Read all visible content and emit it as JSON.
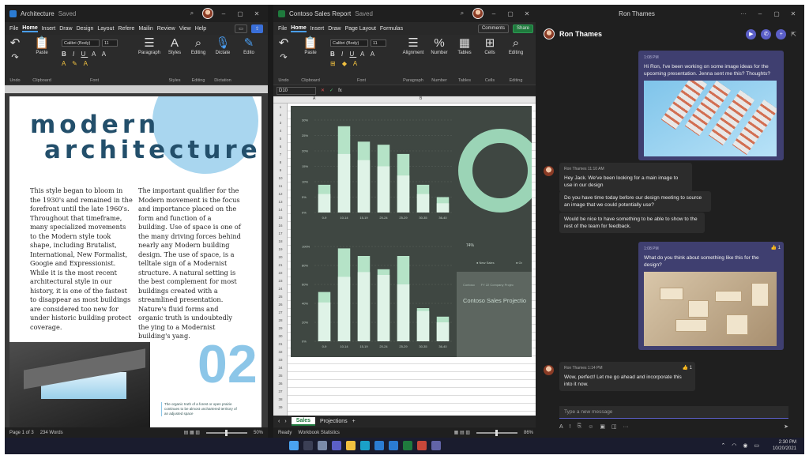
{
  "word": {
    "title": "Architecture",
    "saved": "Saved",
    "menu": [
      "File",
      "Home",
      "Insert",
      "Draw",
      "Design",
      "Layout",
      "Refere",
      "Mailin",
      "Review",
      "View",
      "Help"
    ],
    "ribbon": {
      "undo": "Undo",
      "paste": "Paste",
      "clipboard": "Clipboard",
      "font_name": "Calibri (Body)",
      "font_size": "11",
      "font": "Font",
      "paragraph": "Paragraph",
      "styles": "Styles",
      "editing": "Editing",
      "dictate": "Dictate",
      "dictation": "Dictation",
      "edito": "Edito"
    },
    "heading1": "modern",
    "heading2": "architecture",
    "col1": "This style began to bloom in the 1930's and remained in the forefront until the late 1960's. Throughout that timeframe, many specialized movements to the Modern style took shape, including Brutalist, International, New Formalist, Googie and Expressionist. While it is the most recent architectural style in our history, it is one of the fastest to disappear as most buildings are considered too new for under historic building protect coverage.",
    "col2": "The important qualifier for the Modern movement is the focus and importance placed on the form and function of a building. Use of space is one of the many driving forces behind nearly any Modern building design. The use of space, is a telltale sign of a Modernist structure. A natural setting is the best complement for most buildings created with a streamlined presentation. Nature's fluid forms and organic truth is undoubtedly the ying to a Modernist building's yang.",
    "big_number": "02",
    "caption": "The organic truth of a forest or open prairie continues to be almost unchartered territory of an adjusted space",
    "status": {
      "page": "Page 1 of 3",
      "words": "234 Words",
      "zoom": "50%"
    }
  },
  "excel": {
    "title": "Contoso Sales Report",
    "saved": "Saved",
    "menu": [
      "File",
      "Home",
      "Insert",
      "Draw",
      "Page Layout",
      "Formulas"
    ],
    "comments": "Comments",
    "share": "Share",
    "ribbon": {
      "undo": "Undo",
      "paste": "Paste",
      "clipboard": "Clipboard",
      "font_name": "Calibri (Body)",
      "font_size": "11",
      "font": "Font",
      "alignment": "Alignment",
      "number": "Number",
      "tables": "Tables",
      "cells": "Cells",
      "editing": "Editing",
      "paragraph": "Paragraph"
    },
    "namebox": "D10",
    "fx": "fx",
    "col_headers": [
      "A",
      "B"
    ],
    "project_title": "Contoso Sales Projectio",
    "donut_label": "74%",
    "legend": [
      "New Sales",
      "Gr"
    ],
    "sheet_tabs": [
      "Sales",
      "Projections"
    ],
    "status": {
      "ready": "Ready",
      "stats": "Workbook Statistics",
      "zoom": "86%"
    }
  },
  "chart_data": [
    {
      "type": "bar",
      "categories": [
        "0-9",
        "10-14",
        "15-19",
        "20-24",
        "25-29",
        "30-35",
        "36-40"
      ],
      "series": [
        {
          "values": [
            9,
            28,
            23,
            22,
            19,
            9,
            5
          ]
        },
        {
          "values": [
            6,
            19,
            17,
            15,
            12,
            6,
            3
          ]
        }
      ],
      "ylim": [
        0,
        30
      ],
      "yticks": [
        "0%",
        "5%",
        "10%",
        "15%",
        "20%",
        "25%",
        "30%"
      ]
    },
    {
      "type": "bar",
      "categories": [
        "0-9",
        "10-14",
        "15-19",
        "20-24",
        "25-29",
        "30-35",
        "36-40"
      ],
      "series": [
        {
          "values": [
            52,
            98,
            90,
            76,
            90,
            35,
            26
          ]
        },
        {
          "values": [
            41,
            68,
            73,
            70,
            60,
            32,
            20
          ]
        }
      ],
      "ylim": [
        0,
        100
      ],
      "yticks": [
        "0%",
        "20%",
        "40%",
        "60%",
        "80%",
        "100%"
      ]
    }
  ],
  "teams": {
    "window_title": "Ron Thames",
    "contact": "Ron Thames",
    "msg1_time": "1:08 PM",
    "msg1": "Hi Ron, I've been working on some image ideas for the upcoming presentation. Jenna sent me this? Thoughts?",
    "msg2_meta": "Ron Thames  11:10 AM",
    "msg2a": "Hey Jack. We've been looking for a main image to use in our design",
    "msg2b": "Do you have time today before our design meeting to source an image that we could potentially use?",
    "msg2c": "Would be nice to have something to be able to show to the rest of the team for feedback.",
    "msg3_time": "1:08 PM",
    "msg3": "What do you think about something like this for the design?",
    "msg3_react": "👍 1",
    "msg4_meta": "Ron Thames  1:14 PM",
    "msg4": "Wow, perfect! Let me go ahead and incorporate this into it now.",
    "msg4_react": "👍 1",
    "compose_placeholder": "Type a new message"
  },
  "taskbar": {
    "time": "2:30 PM",
    "date": "10/20/2021"
  }
}
